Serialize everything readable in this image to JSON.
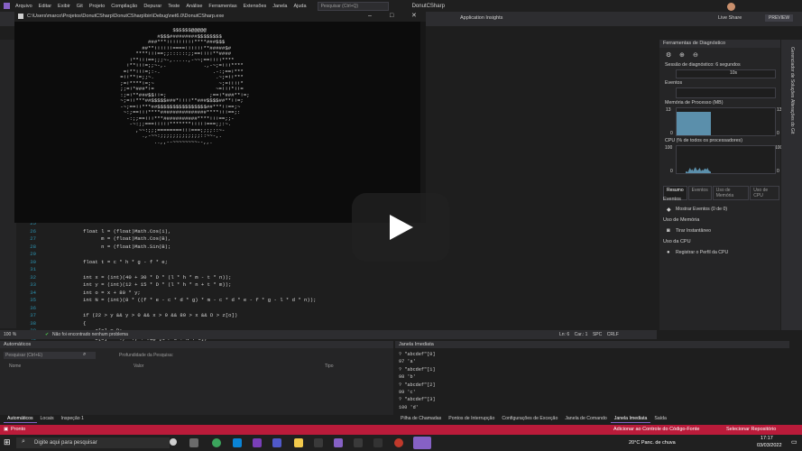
{
  "menubar": {
    "items": [
      "Arquivo",
      "Editar",
      "Exibir",
      "Git",
      "Projeto",
      "Compilação",
      "Depurar",
      "Teste",
      "Análise",
      "Ferramentas",
      "Extensões",
      "Janela",
      "Ajuda"
    ],
    "search_placeholder": "Pesquisar (Ctrl+Q)",
    "project_name": "DonutCSharp"
  },
  "toolbar": {
    "app_insights": "Application Insights",
    "live_share": "Live Share",
    "preview": "PREVIEW"
  },
  "console": {
    "title": "C:\\Users\\marco\\Projetos\\DonutCSharp\\DonutCSharp\\bin\\Debug\\net6.0\\DonutCSharp.exe",
    "donut": "                         $$$$$$@@@@@\n                    #$$$#########$$$$$$$$\n                 ###***!!!!!!!!!****###$$$\n               ##**!!!!!!====!!!!!!**#####$#\n             ****!!!==;;::::::;;==!!!!**####\n           !**!!!==;;;~-,.....,-~~;==!!!!****\n          !**!!!=;;~-,.            .,-~;=!!!****\n         =!**!!!=;:-.                 .-:;==!***\n        =!!**!=;;~.                    .~;=!!***\n        ;=!****!=;~                     ~;=!!!!*\n        ;;=!*###*!=                    ~=!!!*!!=\n        :;=!**###$$!!=;              ;==!*###**!=;\n        ~;=!!***##$$$$$###*!!!!**###$$$$##**!!=;\n        -~;==!!***##$$$$$$$$$$$$$$$$##***!!==;~\n         ~:;==!!!****###############****!!!==;:\n          -:;;==!!!***###########****!!!==;;-\n           -~:;;===!!!!!*******!!!!!===;;:~.\n             ,~~:;;;========!!!===;;;;::~-\n               .,-~~:;;;;;;;;;;;;;::~~-,.\n                   ..,,--~~~~~~~~--,,."
  },
  "editor": {
    "lines": [
      {
        "n": "25",
        "code": ""
      },
      {
        "n": "26",
        "code": "float l = (float)Math.Cos(i),"
      },
      {
        "n": "27",
        "code": "      m = (float)Math.Cos(B),"
      },
      {
        "n": "28",
        "code": "      n = (float)Math.Sin(B);"
      },
      {
        "n": "29",
        "code": ""
      },
      {
        "n": "30",
        "code": "float t = c * h * g - f * e;"
      },
      {
        "n": "31",
        "code": ""
      },
      {
        "n": "32",
        "code": "int x = (int)(40 + 30 * D * (l * h * m - t * n));"
      },
      {
        "n": "33",
        "code": "int y = (int)(12 + 15 * D * (l * h * n + t * m));"
      },
      {
        "n": "34",
        "code": "int o = x + 80 * y;"
      },
      {
        "n": "35",
        "code": "int N = (int)(8 * ((f * e - c * d * g) * m - c * d * e - f * g - l * d * n));"
      },
      {
        "n": "36",
        "code": ""
      },
      {
        "n": "37",
        "code": "if (22 > y && y > 0 && x > 0 && 80 > x && D > z[o])"
      },
      {
        "n": "38",
        "code": "{"
      },
      {
        "n": "39",
        "code": "    z[o] = D;"
      },
      {
        "n": "40",
        "code": "    b[o] = \".,-~:;=!*#$@\"[N > 0 ? N : 0];"
      }
    ],
    "zoom": "100 %",
    "issues": "Não foi encontrado nenhum problema",
    "position": "Ln: 6    Car.: 1    SPC    CRLF"
  },
  "diagnostics": {
    "title": "Ferramentas de Diagnóstico",
    "session": "Sessão de diagnóstico: 6 segundos",
    "session_tick": "10s",
    "events_label": "Eventos",
    "memory_label": "Memória de Processo (MB)",
    "memory_max": "13",
    "memory_min": "0",
    "cpu_label": "CPU (% de todos os processadores)",
    "cpu_max": "100",
    "cpu_min": "0",
    "cpu_samples": [
      2,
      3,
      1,
      5,
      8,
      4,
      6,
      3,
      7,
      9,
      5,
      4,
      6,
      8,
      3,
      5,
      4,
      6,
      7,
      5,
      8,
      4,
      3,
      2
    ],
    "tabs": [
      "Resumo",
      "Eventos",
      "Uso de Memória",
      "Uso de CPU"
    ],
    "sections": {
      "events": "Eventos",
      "show_events": "Mostrar Eventos (0 de 0)",
      "memory_usage": "Uso de Memória",
      "take_snapshot": "Tirar Instantâneo",
      "cpu_usage": "Uso da CPU",
      "record_cpu": "Registrar o Perfil da CPU"
    },
    "side_labels": [
      "Gerenciador de Soluções",
      "Alterações do Git"
    ]
  },
  "autos": {
    "title": "Automáticos",
    "search_placeholder": "Pesquisar (Ctrl+E)",
    "depth_label": "Profundidade da Pesquisa:",
    "columns": [
      "Nome",
      "Valor",
      "Tipo"
    ]
  },
  "immediate": {
    "title": "Janela Imediata",
    "output": "? \"abcdef\"[0]\n97 'a'\n? \"abcdef\"[1]\n98 'b'\n? \"abcdef\"[2]\n99 'c'\n? \"abcdef\"[3]\n100 'd'"
  },
  "bottom_tabs_left": [
    "Automáticos",
    "Locais",
    "Inspeção 1"
  ],
  "bottom_tabs_right": [
    "Pilha de Chamadas",
    "Pontos de Interrupção",
    "Configurações de Exceção",
    "Janela de Comando",
    "Janela Imediata",
    "Saída"
  ],
  "status": {
    "ready": "Pronto",
    "source_control": "Adicionar ao Controle do Código-Fonte",
    "repo": "Selecionar Repositório"
  },
  "taskbar": {
    "search": "Digite aqui para pesquisar",
    "weather": "20°C  Panc. de chuva",
    "time": "17:17",
    "date": "03/03/2022"
  },
  "colors": {
    "accent": "#8661c5",
    "statusbar": "#ba1b3a",
    "console_bg": "#0c0c0c"
  }
}
